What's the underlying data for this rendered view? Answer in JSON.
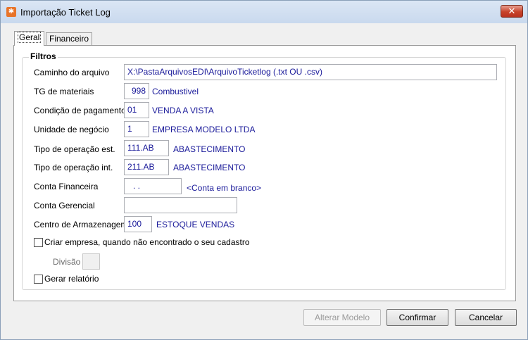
{
  "window": {
    "title": "Importação Ticket Log",
    "close_glyph": "✕",
    "icon": "app-icon"
  },
  "tabs": [
    {
      "label": "Geral",
      "active": true
    },
    {
      "label": "Financeiro",
      "active": false
    }
  ],
  "group": {
    "title": "Filtros"
  },
  "fields": {
    "caminho": {
      "label": "Caminho do arquivo",
      "value": "X:\\PastaArquivosEDI\\ArquivoTicketlog   (.txt OU .csv)"
    },
    "tg_materiais": {
      "label": "TG de materiais",
      "value": "998",
      "desc": "Combustivel"
    },
    "condicao": {
      "label": "Condição de pagamento",
      "value": "01",
      "desc": "VENDA A VISTA"
    },
    "unidade": {
      "label": "Unidade de negócio",
      "value": "1",
      "desc": "EMPRESA MODELO LTDA"
    },
    "tipo_op_est": {
      "label": "Tipo de operação est.",
      "value": "111.AB",
      "desc": "ABASTECIMENTO"
    },
    "tipo_op_int": {
      "label": "Tipo de operação int.",
      "value": "211.AB",
      "desc": "ABASTECIMENTO"
    },
    "conta_fin": {
      "label": "Conta Financeira",
      "value": ". .",
      "desc": "<Conta em branco>"
    },
    "conta_ger": {
      "label": "Conta Gerencial",
      "value": ""
    },
    "centro": {
      "label": "Centro de Armazenagem",
      "value": "100",
      "desc": "ESTOQUE VENDAS"
    }
  },
  "checkboxes": {
    "criar_empresa": {
      "label": "Criar empresa, quando não encontrado o seu cadastro",
      "checked": false
    },
    "gerar_relatorio": {
      "label": "Gerar relatório",
      "checked": false
    }
  },
  "divisao": {
    "label": "Divisão",
    "value": ""
  },
  "buttons": {
    "alterar": {
      "label": "Alterar Modelo",
      "enabled": false
    },
    "confirmar": {
      "label": "Confirmar",
      "enabled": true
    },
    "cancelar": {
      "label": "Cancelar",
      "enabled": true
    }
  },
  "colors": {
    "value_text": "#1a1a9a",
    "close_button": "#c7432b",
    "app_icon": "#e8742a"
  }
}
